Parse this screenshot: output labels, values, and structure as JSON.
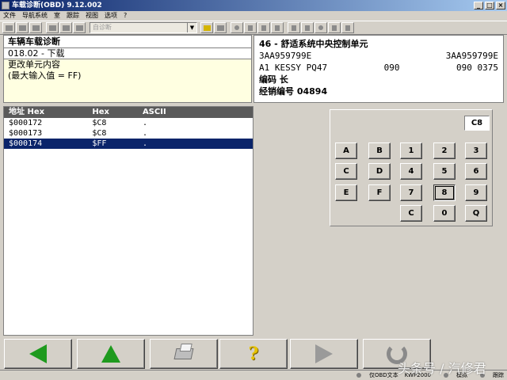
{
  "window": {
    "title": "车载诊断(OBD) 9.12.002",
    "min_label": "_",
    "max_label": "□",
    "close_label": "×"
  },
  "menu": [
    "文件",
    "导航系统",
    "室",
    "跟踪",
    "视图",
    "选项",
    "?"
  ],
  "toolbar": {
    "combo_value": "自诊断",
    "combo_arrow": "▼"
  },
  "info_left": {
    "title": "车辆车载诊断",
    "function": "018.02 - 下载",
    "prompt_line1": "更改单元内容",
    "prompt_line2": "(最大输入值 = FF)"
  },
  "info_right": {
    "line1": "46 - 舒适系统中央控制单元",
    "part_left": "3AA959799E",
    "part_right": "3AA959799E",
    "component_left": "A1 KESSY PQ47",
    "component_mid": "090",
    "component_right": "090  0375",
    "coding_label": "编码 长",
    "dealer_label": "经销编号 04894"
  },
  "table": {
    "headers": [
      "地址 Hex",
      "Hex",
      "ASCII"
    ],
    "rows": [
      {
        "addr": "$000172",
        "hex": "$C8",
        "ascii": ".",
        "selected": false
      },
      {
        "addr": "$000173",
        "hex": "$C8",
        "ascii": ".",
        "selected": false
      },
      {
        "addr": "$000174",
        "hex": "$FF",
        "ascii": ".",
        "selected": true
      }
    ]
  },
  "keypad": {
    "display": "C8",
    "keys": [
      "A",
      "B",
      "1",
      "2",
      "3",
      "C",
      "D",
      "4",
      "5",
      "6",
      "E",
      "F",
      "7",
      "8",
      "9",
      "C",
      "0",
      "Q"
    ]
  },
  "status": {
    "item1": "仅OBD文本",
    "item2": "KWP2000",
    "item3": "模拟",
    "item4": "跟踪"
  },
  "watermark": "头条号 / 汽修君",
  "colors": {
    "nav_green": "#1e9a1e",
    "selection": "#0a246a",
    "info_bg": "#ffffe1"
  }
}
